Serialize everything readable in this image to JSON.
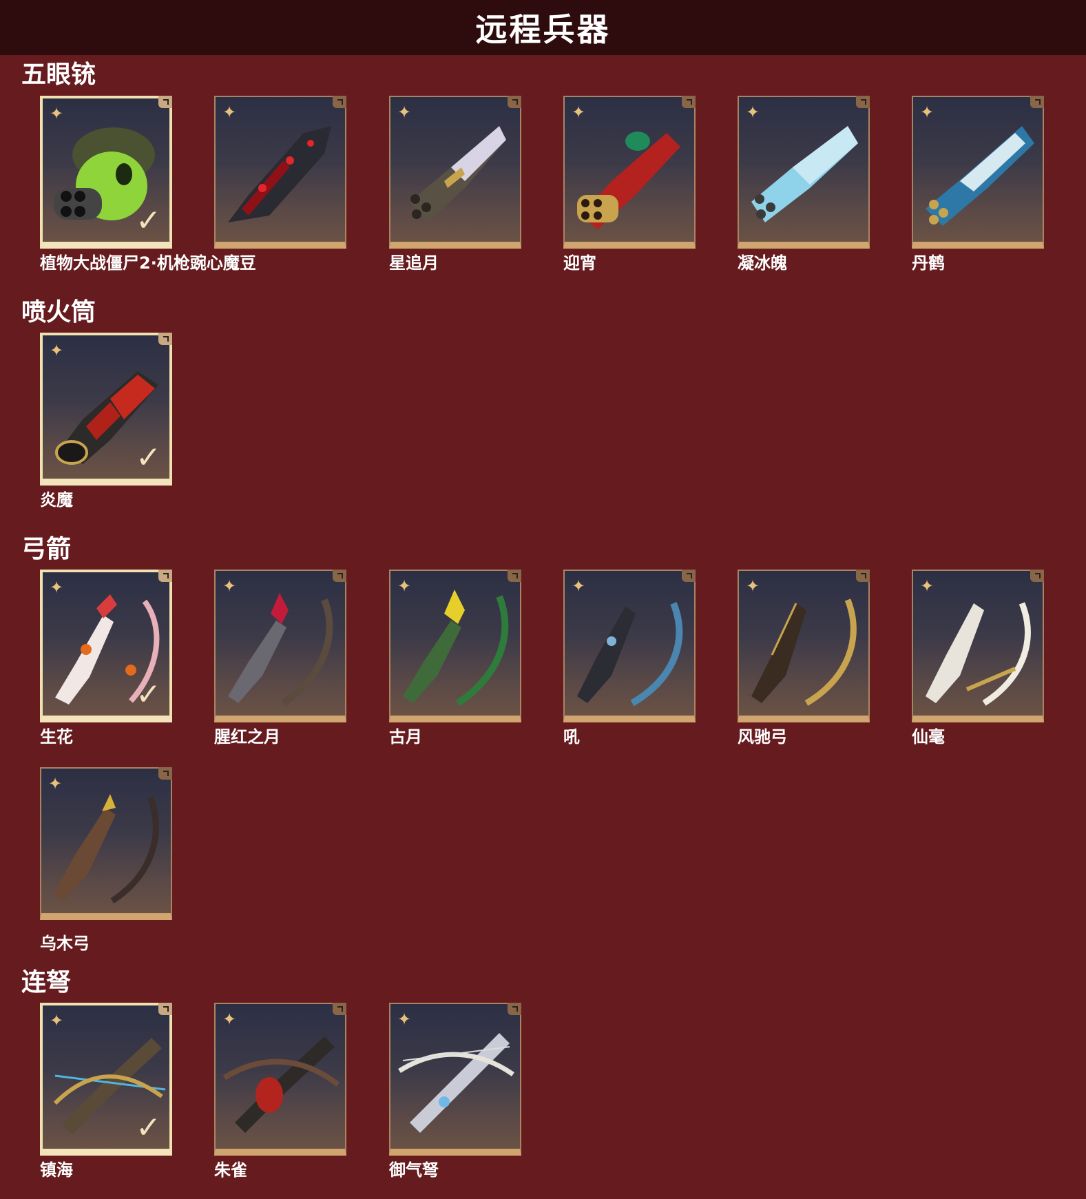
{
  "header": {
    "title": "远程兵器"
  },
  "sections": [
    {
      "title": "五眼铳",
      "items": [
        {
          "name": "植物大战僵尸2·机枪豌心魔豆",
          "selected": true
        },
        {
          "name": "",
          "selected": false
        },
        {
          "name": "星追月",
          "selected": false
        },
        {
          "name": "迎宵",
          "selected": false
        },
        {
          "name": "凝冰魄",
          "selected": false
        },
        {
          "name": "丹鹤",
          "selected": false
        }
      ]
    },
    {
      "title": "喷火筒",
      "items": [
        {
          "name": "炎魔",
          "selected": true
        }
      ]
    },
    {
      "title": "弓箭",
      "items": [
        {
          "name": "生花",
          "selected": true
        },
        {
          "name": "腥红之月",
          "selected": false
        },
        {
          "name": "古月",
          "selected": false
        },
        {
          "name": "吼",
          "selected": false
        },
        {
          "name": "风驰弓",
          "selected": false
        },
        {
          "name": "仙毫",
          "selected": false
        },
        {
          "name": "乌木弓",
          "selected": false
        }
      ]
    },
    {
      "title": "连弩",
      "items": [
        {
          "name": "镇海",
          "selected": true
        },
        {
          "name": "朱雀",
          "selected": false
        },
        {
          "name": "御气弩",
          "selected": false
        }
      ]
    }
  ],
  "badge_icon": "star-badge-icon",
  "selected_icon": "checkmark-icon",
  "colors": {
    "background": "#661b1f",
    "header": "#2e0c0e",
    "frame_gold": "#d1a56f",
    "selected_frame": "#f1e0b0"
  }
}
